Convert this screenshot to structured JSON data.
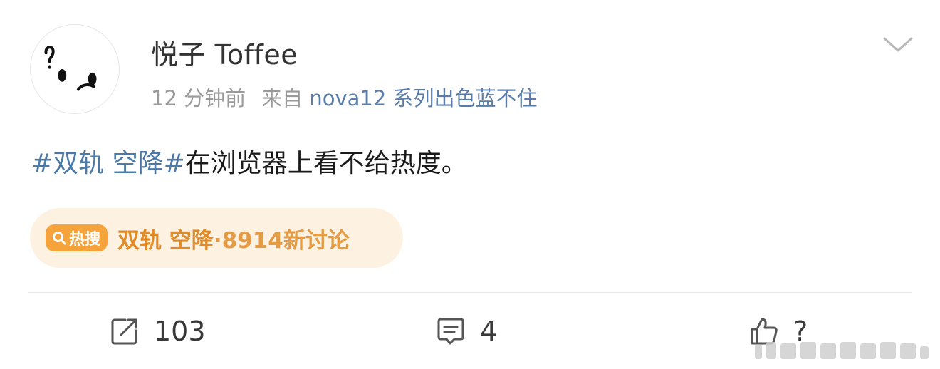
{
  "post": {
    "user": {
      "name": "悦子 Toffee"
    },
    "time": "12 分钟前",
    "source_prefix": "来自",
    "source_device": "nova12 系列出色蓝不住",
    "content": {
      "hashtag": "#双轨 空降#",
      "text": "在浏览器上看不给热度。"
    },
    "hot_search": {
      "badge_label": "热搜",
      "topic": "双轨 空降",
      "count_text": "·8914新讨论"
    },
    "actions": {
      "repost_count": "103",
      "comment_count": "4",
      "like_count": "?"
    }
  },
  "colors": {
    "link_blue": "#4b7aa8",
    "meta_gray": "#9a9a9a",
    "hot_bg": "#fdf1e2",
    "hot_orange": "#e08a28",
    "badge_orange": "#f7a33b"
  },
  "icons": [
    "avatar-doodle",
    "chevron-down-icon",
    "search-icon",
    "repost-icon",
    "comment-icon",
    "like-icon"
  ]
}
